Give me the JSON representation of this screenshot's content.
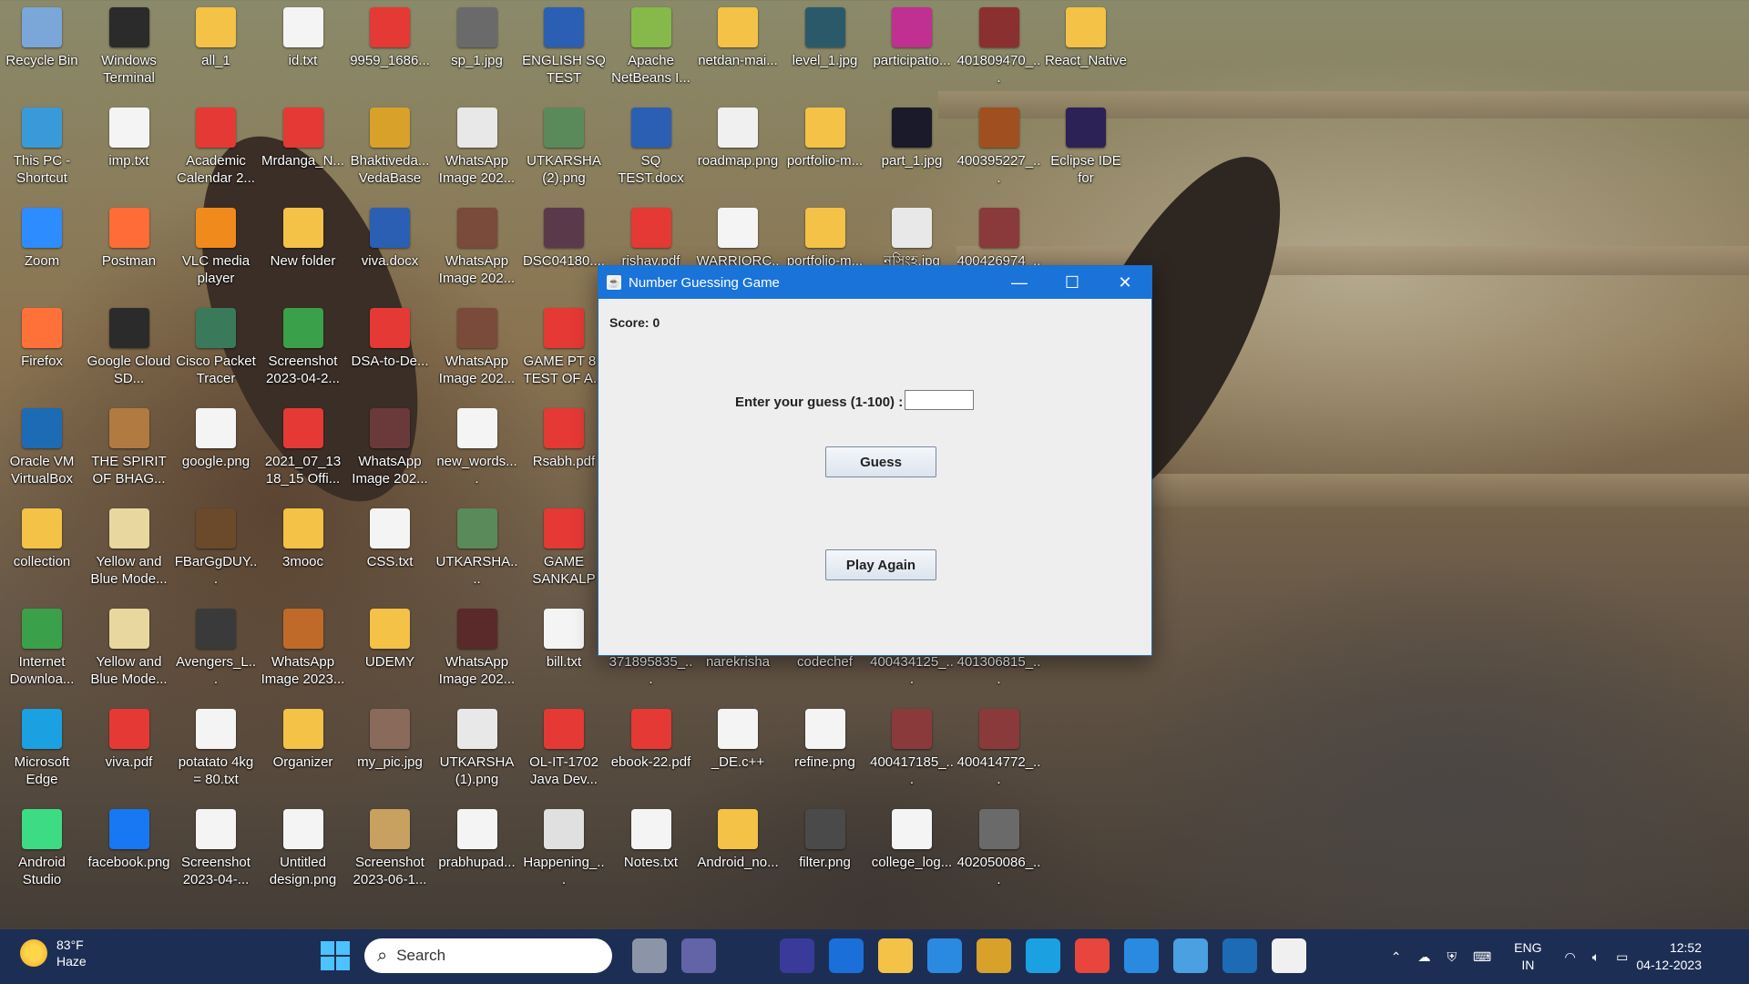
{
  "desktop": {
    "icons": [
      {
        "label": "Recycle Bin",
        "icon": "recycle-bin-icon",
        "color": "#7aa7d8"
      },
      {
        "label": "Windows Terminal",
        "icon": "terminal-icon",
        "color": "#2b2b2b"
      },
      {
        "label": "all_1",
        "icon": "folder-icon",
        "color": "#f3c246"
      },
      {
        "label": "id.txt",
        "icon": "text-file-icon",
        "color": "#f4f4f4"
      },
      {
        "label": "9959_1686...",
        "icon": "pdf-icon",
        "color": "#e53935"
      },
      {
        "label": "sp_1.jpg",
        "icon": "image-icon",
        "color": "#6a6a6a"
      },
      {
        "label": "ENGLISH SQ TEST (1).docx",
        "icon": "word-icon",
        "color": "#2b5fb4"
      },
      {
        "label": "Apache NetBeans I...",
        "icon": "netbeans-icon",
        "color": "#86b94a"
      },
      {
        "label": "netdan-mai...",
        "icon": "folder-icon",
        "color": "#f3c246"
      },
      {
        "label": "level_1.jpg",
        "icon": "image-icon",
        "color": "#2a5a6a"
      },
      {
        "label": "participatio...",
        "icon": "image-icon",
        "color": "#c03090"
      },
      {
        "label": "401809470_...",
        "icon": "image-icon",
        "color": "#8a3030"
      },
      {
        "label": "React_Native",
        "icon": "folder-icon",
        "color": "#f3c246"
      },
      {
        "label": "This PC - Shortcut",
        "icon": "computer-icon",
        "color": "#3a9ad9"
      },
      {
        "label": "imp.txt",
        "icon": "text-file-icon",
        "color": "#f4f4f4"
      },
      {
        "label": "Academic Calendar 2...",
        "icon": "pdf-icon",
        "color": "#e53935"
      },
      {
        "label": "Mrdanga_N...",
        "icon": "pdf-icon",
        "color": "#e53935"
      },
      {
        "label": "Bhaktiveda... VedaBase 2...",
        "icon": "vedabase-icon",
        "color": "#d8a12a"
      },
      {
        "label": "WhatsApp Image 202...",
        "icon": "image-icon",
        "color": "#e8e8e8"
      },
      {
        "label": "UTKARSHA (2).png",
        "icon": "image-icon",
        "color": "#5a8a5a"
      },
      {
        "label": "SQ TEST.docx",
        "icon": "word-icon",
        "color": "#2b5fb4"
      },
      {
        "label": "roadmap.png",
        "icon": "image-icon",
        "color": "#f0f0f0"
      },
      {
        "label": "portfolio-m...",
        "icon": "folder-icon",
        "color": "#f3c246"
      },
      {
        "label": "part_1.jpg",
        "icon": "image-icon",
        "color": "#1a1a2a"
      },
      {
        "label": "400395227_...",
        "icon": "image-icon",
        "color": "#a05020"
      },
      {
        "label": "Eclipse IDE for Enterpris...",
        "icon": "eclipse-icon",
        "color": "#2c2255"
      },
      {
        "label": "Zoom",
        "icon": "zoom-icon",
        "color": "#2d8cff"
      },
      {
        "label": "Postman",
        "icon": "postman-icon",
        "color": "#ff6c37"
      },
      {
        "label": "VLC media player",
        "icon": "vlc-icon",
        "color": "#f08a1c"
      },
      {
        "label": "New folder",
        "icon": "folder-icon",
        "color": "#f3c246"
      },
      {
        "label": "viva.docx",
        "icon": "word-icon",
        "color": "#2b5fb4"
      },
      {
        "label": "WhatsApp Image 202...",
        "icon": "image-icon",
        "color": "#7a4a3a"
      },
      {
        "label": "DSC04180....",
        "icon": "image-icon",
        "color": "#5a3a4a"
      },
      {
        "label": "rishav.pdf",
        "icon": "pdf-icon",
        "color": "#e53935"
      },
      {
        "label": "WARRIORC...",
        "icon": "file-icon",
        "color": "#f4f4f4"
      },
      {
        "label": "portfolio-m...",
        "icon": "folder-icon",
        "color": "#f3c246"
      },
      {
        "label": "নৃসিংহ.jpg",
        "icon": "image-icon",
        "color": "#e8e8e8"
      },
      {
        "label": "400426974_...",
        "icon": "image-icon",
        "color": "#8a3a3a"
      },
      {
        "label": "Firefox",
        "icon": "firefox-icon",
        "color": "#ff7139"
      },
      {
        "label": "Google Cloud SD...",
        "icon": "terminal-icon",
        "color": "#2b2b2b"
      },
      {
        "label": "Cisco Packet Tracer",
        "icon": "cisco-icon",
        "color": "#3a7a5a"
      },
      {
        "label": "Screenshot 2023-04-2...",
        "icon": "image-icon",
        "color": "#3aa04a"
      },
      {
        "label": "DSA-to-De...",
        "icon": "pdf-icon",
        "color": "#e53935"
      },
      {
        "label": "WhatsApp Image 202...",
        "icon": "image-icon",
        "color": "#7a4a3a"
      },
      {
        "label": "GAME PT 8 - TEST OF A...",
        "icon": "pdf-icon",
        "color": "#e53935"
      },
      {
        "label": "Oracle VM VirtualBox",
        "icon": "virtualbox-icon",
        "color": "#1d6bb5"
      },
      {
        "label": "THE SPIRIT OF BHAG...",
        "icon": "image-icon",
        "color": "#b07a40"
      },
      {
        "label": "google.png",
        "icon": "image-icon",
        "color": "#f4f4f4"
      },
      {
        "label": "2021_07_13 18_15 Offi...",
        "icon": "pdf-icon",
        "color": "#e53935"
      },
      {
        "label": "WhatsApp Image 202...",
        "icon": "image-icon",
        "color": "#6a3a3a"
      },
      {
        "label": "new_words....",
        "icon": "text-file-icon",
        "color": "#f4f4f4"
      },
      {
        "label": "Rsabh.pdf",
        "icon": "pdf-icon",
        "color": "#e53935"
      },
      {
        "label": "collection",
        "icon": "folder-icon",
        "color": "#f3c246"
      },
      {
        "label": "Yellow and Blue Mode...",
        "icon": "image-icon",
        "color": "#e8d8a0"
      },
      {
        "label": "FBarGgDUY...",
        "icon": "image-icon",
        "color": "#6a4a2a"
      },
      {
        "label": "3mooc",
        "icon": "folder-icon",
        "color": "#f3c246"
      },
      {
        "label": "CSS.txt",
        "icon": "text-file-icon",
        "color": "#f4f4f4"
      },
      {
        "label": "UTKARSHA....",
        "icon": "image-icon",
        "color": "#5a8a5a"
      },
      {
        "label": "GAME SANKALP C...",
        "icon": "pdf-icon",
        "color": "#e53935"
      },
      {
        "label": "Internet Downloa...",
        "icon": "idm-icon",
        "color": "#3aa04a"
      },
      {
        "label": "Yellow and Blue Mode...",
        "icon": "image-icon",
        "color": "#e8d8a0"
      },
      {
        "label": "Avengers_L...",
        "icon": "image-icon",
        "color": "#3a3a3a"
      },
      {
        "label": "WhatsApp Image 2023...",
        "icon": "image-icon",
        "color": "#c06a2a"
      },
      {
        "label": "UDEMY",
        "icon": "folder-icon",
        "color": "#f3c246"
      },
      {
        "label": "WhatsApp Image 202...",
        "icon": "image-icon",
        "color": "#5a2a2a"
      },
      {
        "label": "bill.txt",
        "icon": "text-file-icon",
        "color": "#f4f4f4"
      },
      {
        "label": "371895835_...",
        "icon": "image-icon",
        "color": "#4a4a4a"
      },
      {
        "label": "narekrisha",
        "icon": "image-icon",
        "color": "#4a4a4a"
      },
      {
        "label": "codechef",
        "icon": "image-icon",
        "color": "#4a4a4a"
      },
      {
        "label": "400434125_...",
        "icon": "image-icon",
        "color": "#4a4a4a"
      },
      {
        "label": "401306815_...",
        "icon": "image-icon",
        "color": "#4a4a4a"
      },
      {
        "label": "Microsoft Edge",
        "icon": "edge-icon",
        "color": "#1ba1e2"
      },
      {
        "label": "viva.pdf",
        "icon": "pdf-icon",
        "color": "#e53935"
      },
      {
        "label": "potatato 4kg = 80.txt",
        "icon": "text-file-icon",
        "color": "#f4f4f4"
      },
      {
        "label": "Organizer",
        "icon": "folder-icon",
        "color": "#f3c246"
      },
      {
        "label": "my_pic.jpg",
        "icon": "image-icon",
        "color": "#8a6a5a"
      },
      {
        "label": "UTKARSHA (1).png",
        "icon": "image-icon",
        "color": "#e8e8e8"
      },
      {
        "label": "OL-IT-1702 Java Dev...",
        "icon": "pdf-icon",
        "color": "#e53935"
      },
      {
        "label": "ebook-22.pdf",
        "icon": "pdf-icon",
        "color": "#e53935"
      },
      {
        "label": "_DE.c++",
        "icon": "cpp-icon",
        "color": "#f4f4f4"
      },
      {
        "label": "refine.png",
        "icon": "image-icon",
        "color": "#f4f4f4"
      },
      {
        "label": "400417185_...",
        "icon": "image-icon",
        "color": "#8a3a3a"
      },
      {
        "label": "400414772_...",
        "icon": "image-icon",
        "color": "#8a3a3a"
      },
      {
        "label": "Android Studio",
        "icon": "android-studio-icon",
        "color": "#3ddc84"
      },
      {
        "label": "facebook.png",
        "icon": "facebook-icon",
        "color": "#1877f2"
      },
      {
        "label": "Screenshot 2023-04-...",
        "icon": "image-icon",
        "color": "#f4f4f4"
      },
      {
        "label": "Untitled design.png",
        "icon": "image-icon",
        "color": "#f4f4f4"
      },
      {
        "label": "Screenshot 2023-06-1...",
        "icon": "image-icon",
        "color": "#c8a060"
      },
      {
        "label": "prabhupad...",
        "icon": "text-file-icon",
        "color": "#f4f4f4"
      },
      {
        "label": "Happening_...",
        "icon": "image-icon",
        "color": "#e0e0e0"
      },
      {
        "label": "Notes.txt",
        "icon": "text-file-icon",
        "color": "#f4f4f4"
      },
      {
        "label": "Android_no...",
        "icon": "folder-icon",
        "color": "#f3c246"
      },
      {
        "label": "filter.png",
        "icon": "image-icon",
        "color": "#4a4a4a"
      },
      {
        "label": "college_log...",
        "icon": "image-icon",
        "color": "#f4f4f4"
      },
      {
        "label": "402050086_...",
        "icon": "image-icon",
        "color": "#6a6a6a"
      }
    ]
  },
  "window": {
    "title": "Number Guessing Game",
    "minimize": "—",
    "maximize": "☐",
    "close": "✕",
    "score_text": "Score: 0",
    "prompt": "Enter your guess (1-100) :",
    "guess_value": "",
    "guess_button": "Guess",
    "play_again_button": "Play Again"
  },
  "taskbar": {
    "weather_temp": "83°F",
    "weather_desc": "Haze",
    "search_placeholder": "Search",
    "lang_top": "ENG",
    "lang_bottom": "IN",
    "time": "12:52",
    "date": "04-12-2023",
    "apps": [
      {
        "icon": "task-view-icon",
        "color": "#8c95a8"
      },
      {
        "icon": "chat-icon",
        "color": "#6264a7"
      },
      {
        "icon": "cortana-icon",
        "color": "#1d2e55"
      },
      {
        "icon": "app-icon",
        "color": "#3a3a9a"
      },
      {
        "icon": "store-icon",
        "color": "#1a6fd9"
      },
      {
        "icon": "file-explorer-icon",
        "color": "#f3c246"
      },
      {
        "icon": "mail-icon",
        "color": "#2a8ae0"
      },
      {
        "icon": "vedabase-icon",
        "color": "#d8a12a"
      },
      {
        "icon": "edge-icon",
        "color": "#1ba1e2"
      },
      {
        "icon": "chrome-icon",
        "color": "#e8453c"
      },
      {
        "icon": "vscode-icon",
        "color": "#2a8ae0"
      },
      {
        "icon": "notepad-icon",
        "color": "#4aa0e0"
      },
      {
        "icon": "virtualbox-icon",
        "color": "#1d6bb5"
      },
      {
        "icon": "java-icon",
        "color": "#f0f0f0"
      }
    ]
  }
}
